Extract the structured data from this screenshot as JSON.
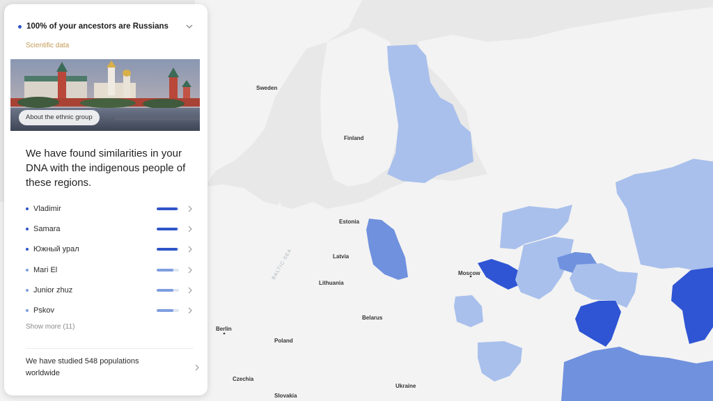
{
  "panel": {
    "title": "100% of your ancestors are Russians",
    "subtitle": "Scientific data",
    "about_button": "About the ethnic group",
    "headline": "We have found similarities in your DNA with the indigenous people of these regions.",
    "regions": [
      {
        "name": "Vladimir",
        "level": 0.95,
        "color": "#2f55c8"
      },
      {
        "name": "Samara",
        "level": 0.95,
        "color": "#2f55c8"
      },
      {
        "name": "Южный урал",
        "level": 0.95,
        "color": "#2f55c8"
      },
      {
        "name": "Mari El",
        "level": 0.75,
        "color": "#7f9ee0"
      },
      {
        "name": "Junior zhuz",
        "level": 0.75,
        "color": "#7f9ee0"
      },
      {
        "name": "Pskov",
        "level": 0.75,
        "color": "#7f9ee0"
      }
    ],
    "show_more": "Show more (11)",
    "studied": "We have studied 548 populations worldwide"
  },
  "map": {
    "labels": {
      "sweden": "Sweden",
      "finland": "Finland",
      "estonia": "Estonia",
      "latvia": "Latvia",
      "lithuania": "Lithuania",
      "belarus": "Belarus",
      "moscow": "Moscow",
      "berlin": "Berlin",
      "poland": "Poland",
      "czechia": "Czechia",
      "slovakia": "Slovakia",
      "ukraine": "Ukraine",
      "baltic_sea": "BALTIC SEA"
    },
    "colors": {
      "land": "#f2f2f2",
      "water": "#e6e6e6",
      "region_light": "#a9c0ec",
      "region_mid": "#6f91de",
      "region_dark": "#2f55d4"
    }
  }
}
